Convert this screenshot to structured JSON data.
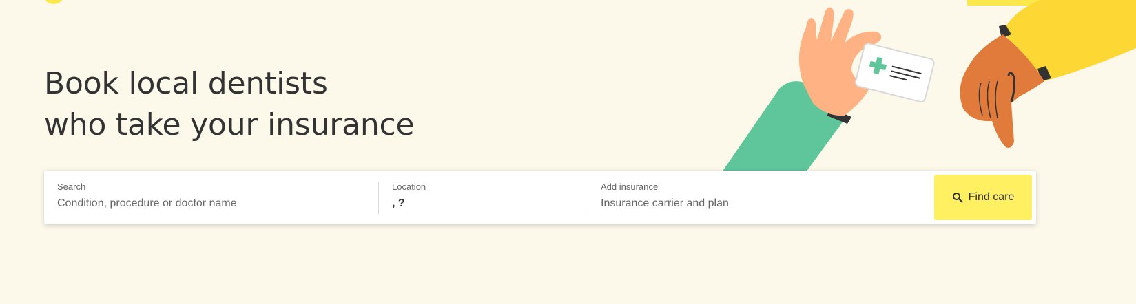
{
  "brand": {
    "accent_yellow": "#fff061",
    "background": "#fcf9eb",
    "logo_color": "#fce84d"
  },
  "hero": {
    "headline_line1": "Book local dentists",
    "headline_line2": "who take your insurance"
  },
  "search": {
    "search_label": "Search",
    "search_placeholder": "Condition, procedure or doctor name",
    "location_label": "Location",
    "location_value": ", ?",
    "insurance_label": "Add insurance",
    "insurance_placeholder": "Insurance carrier and plan",
    "button_label": "Find care",
    "button_icon": "search-icon"
  },
  "illustration": {
    "description_icon": "hands-passing-insurance-card-icon",
    "sleeve_green": "#5fc69b",
    "sleeve_yellow": "#fdd835",
    "skin_light": "#ffb283",
    "skin_dark": "#e07b3c",
    "card_cross": "#5fc69b"
  }
}
